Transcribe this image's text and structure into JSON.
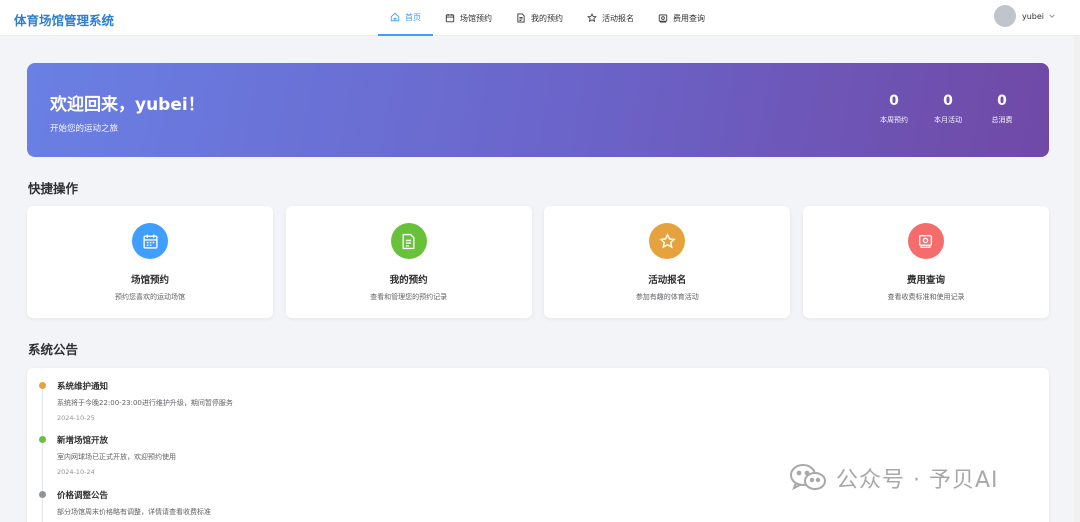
{
  "app": {
    "title": "体育场馆管理系统"
  },
  "nav": {
    "items": [
      {
        "label": "首页",
        "icon": "home-icon",
        "active": true
      },
      {
        "label": "场馆预约",
        "icon": "calendar-icon"
      },
      {
        "label": "我的预约",
        "icon": "document-icon"
      },
      {
        "label": "活动报名",
        "icon": "star-icon"
      },
      {
        "label": "费用查询",
        "icon": "money-icon"
      }
    ]
  },
  "user": {
    "name": "yubei"
  },
  "banner": {
    "title": "欢迎回来，yubei！",
    "subtitle": "开始您的运动之旅",
    "stats": [
      {
        "value": "0",
        "label": "本周预约"
      },
      {
        "value": "0",
        "label": "本月活动"
      },
      {
        "value": "0",
        "label": "总消费"
      }
    ]
  },
  "quick_actions": {
    "title": "快捷操作",
    "cards": [
      {
        "title": "场馆预约",
        "desc": "预约您喜欢的运动场馆",
        "icon": "calendar-icon",
        "color": "#409eff"
      },
      {
        "title": "我的预约",
        "desc": "查看和管理您的预约记录",
        "icon": "document-icon",
        "color": "#67c23a"
      },
      {
        "title": "活动报名",
        "desc": "参加有趣的体育活动",
        "icon": "star-icon",
        "color": "#e6a23c"
      },
      {
        "title": "费用查询",
        "desc": "查看收费标准和使用记录",
        "icon": "money-icon",
        "color": "#f56c6c"
      }
    ]
  },
  "announcements": {
    "title": "系统公告",
    "items": [
      {
        "title": "系统维护通知",
        "content": "系统将于今晚22:00-23:00进行维护升级，期间暂停服务",
        "date": "2024-10-25",
        "color": "#e6a23c"
      },
      {
        "title": "新增场馆开放",
        "content": "室内网球场已正式开放，欢迎预约使用",
        "date": "2024-10-24",
        "color": "#67c23a"
      },
      {
        "title": "价格调整公告",
        "content": "部分场馆周末价格略有调整，详情请查看收费标准",
        "date": "",
        "color": "#909399"
      }
    ]
  },
  "watermark": {
    "text": "公众号 · 予贝AI"
  }
}
